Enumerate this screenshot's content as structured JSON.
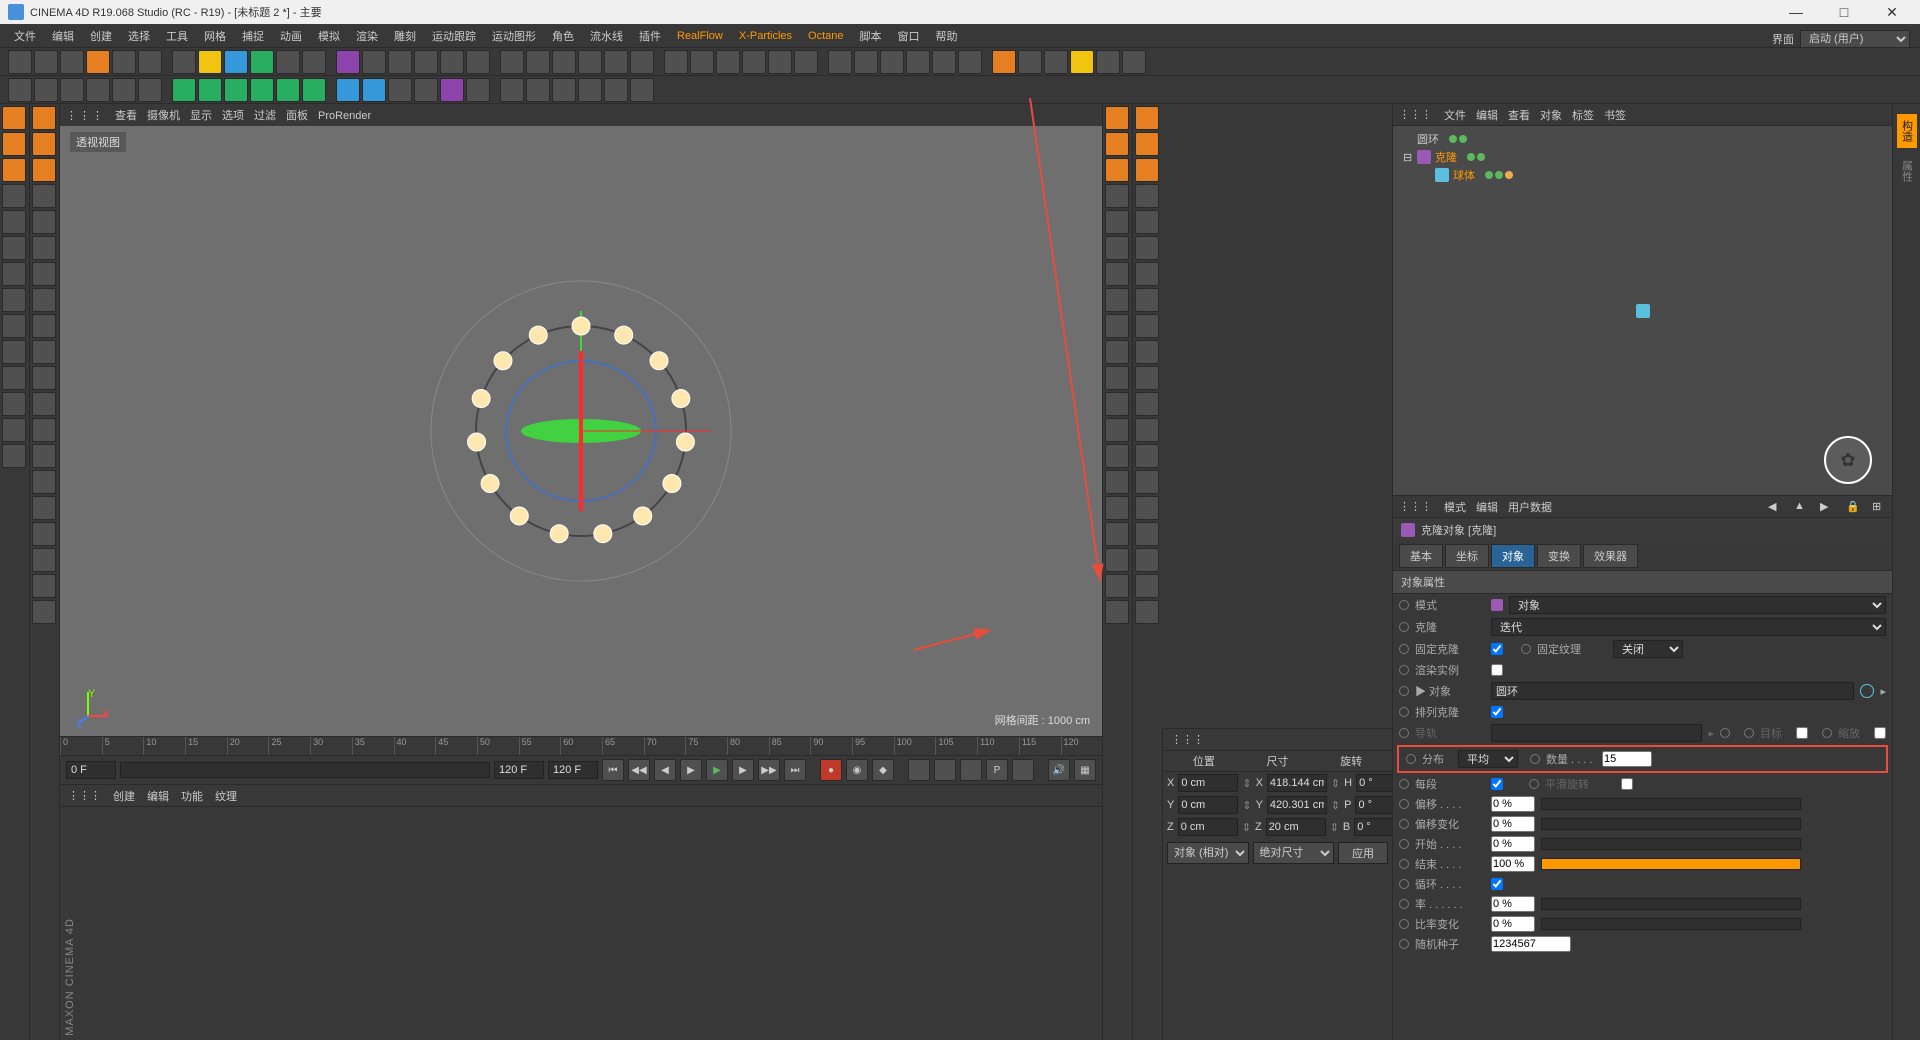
{
  "titlebar": {
    "title": "CINEMA 4D R19.068 Studio (RC - R19) - [未标题 2 *] - 主要"
  },
  "winbtns": {
    "min": "—",
    "max": "□",
    "close": "✕"
  },
  "menubar": [
    "文件",
    "编辑",
    "创建",
    "选择",
    "工具",
    "网格",
    "捕捉",
    "动画",
    "模拟",
    "渲染",
    "雕刻",
    "运动跟踪",
    "运动图形",
    "角色",
    "流水线",
    "插件",
    "RealFlow",
    "X-Particles",
    "Octane",
    "脚本",
    "窗口",
    "帮助"
  ],
  "menubar_hl": [
    16,
    17,
    18
  ],
  "layout": {
    "label": "界面",
    "value": "启动 (用户)"
  },
  "viewport": {
    "menus": [
      "查看",
      "摄像机",
      "显示",
      "选项",
      "过滤",
      "面板",
      "ProRender"
    ],
    "title": "透视视图",
    "grid": "网格间距 : 1000 cm",
    "axes": {
      "x": "X",
      "y": "Y",
      "z": "Z"
    }
  },
  "objmgr": {
    "tabs": [
      "文件",
      "编辑",
      "查看",
      "对象",
      "标签",
      "书签"
    ],
    "items": [
      {
        "indent": 0,
        "icon": "ring",
        "name": "圆环",
        "sel": false,
        "dots": [
          "g",
          "g"
        ]
      },
      {
        "indent": 0,
        "icon": "clone",
        "name": "克隆",
        "sel": true,
        "dots": [
          "g",
          "g"
        ],
        "expand": true
      },
      {
        "indent": 1,
        "icon": "sphere",
        "name": "球体",
        "sel": true,
        "dots": [
          "g",
          "g",
          "o"
        ]
      }
    ]
  },
  "attr": {
    "tabs": [
      "模式",
      "编辑",
      "用户数据"
    ],
    "header": "克隆对象 [克隆]",
    "subtabs": [
      "基本",
      "坐标",
      "对象",
      "变换",
      "效果器"
    ],
    "active_subtab": 2,
    "section": "对象属性",
    "rows": {
      "mode_label": "模式",
      "mode_value": "对象",
      "clone_label": "克隆",
      "clone_value": "迭代",
      "fixclone_label": "固定克隆",
      "fixtex_label": "固定纹理",
      "fixtex_value": "关闭",
      "instance_label": "渲染实例",
      "object_label": "▶ 对象",
      "object_value": "圆环",
      "align_label": "排列克隆",
      "rail_label": "导轨",
      "target_label": "目标",
      "scale_label": "缩放",
      "dist_label": "分布",
      "dist_value": "平均",
      "count_label": "数量 . . . .",
      "count_value": "15",
      "perseg_label": "每段",
      "smoothrot_label": "平滑旋转",
      "offset_label": "偏移 . . . .",
      "offset_value": "0 %",
      "offsetvar_label": "偏移变化",
      "offsetvar_value": "0 %",
      "start_label": "开始 . . . .",
      "start_value": "0 %",
      "end_label": "结束 . . . .",
      "end_value": "100 %",
      "loop_label": "循环 . . . .",
      "rate_label": "率 . . . . . .",
      "rate_value": "0 %",
      "ratevar_label": "比率变化",
      "ratevar_value": "0 %",
      "seed_label": "随机种子",
      "seed_value": "1234567"
    }
  },
  "timeline": {
    "ticks": [
      "0",
      "5",
      "10",
      "15",
      "20",
      "25",
      "30",
      "35",
      "40",
      "45",
      "50",
      "55",
      "60",
      "65",
      "70",
      "75",
      "80",
      "85",
      "90",
      "95",
      "100",
      "105",
      "110",
      "115",
      "120"
    ],
    "cur": "0 F",
    "start": "0 F",
    "end": "120 F",
    "end2": "120 F"
  },
  "bottomtabs": [
    "创建",
    "编辑",
    "功能",
    "纹理"
  ],
  "maxon": "MAXON CINEMA 4D",
  "coords": {
    "hdr": [
      "位置",
      "尺寸",
      "旋转"
    ],
    "rows": [
      {
        "axis": "X",
        "pos": "0 cm",
        "size": "418.144 cm",
        "rot_lbl": "H",
        "rot": "0 °"
      },
      {
        "axis": "Y",
        "pos": "0 cm",
        "size": "420.301 cm",
        "rot_lbl": "P",
        "rot": "0 °"
      },
      {
        "axis": "Z",
        "pos": "0 cm",
        "size": "20 cm",
        "rot_lbl": "B",
        "rot": "0 °"
      }
    ],
    "sel1": "对象 (相对)",
    "sel2": "绝对尺寸",
    "apply": "应用"
  }
}
